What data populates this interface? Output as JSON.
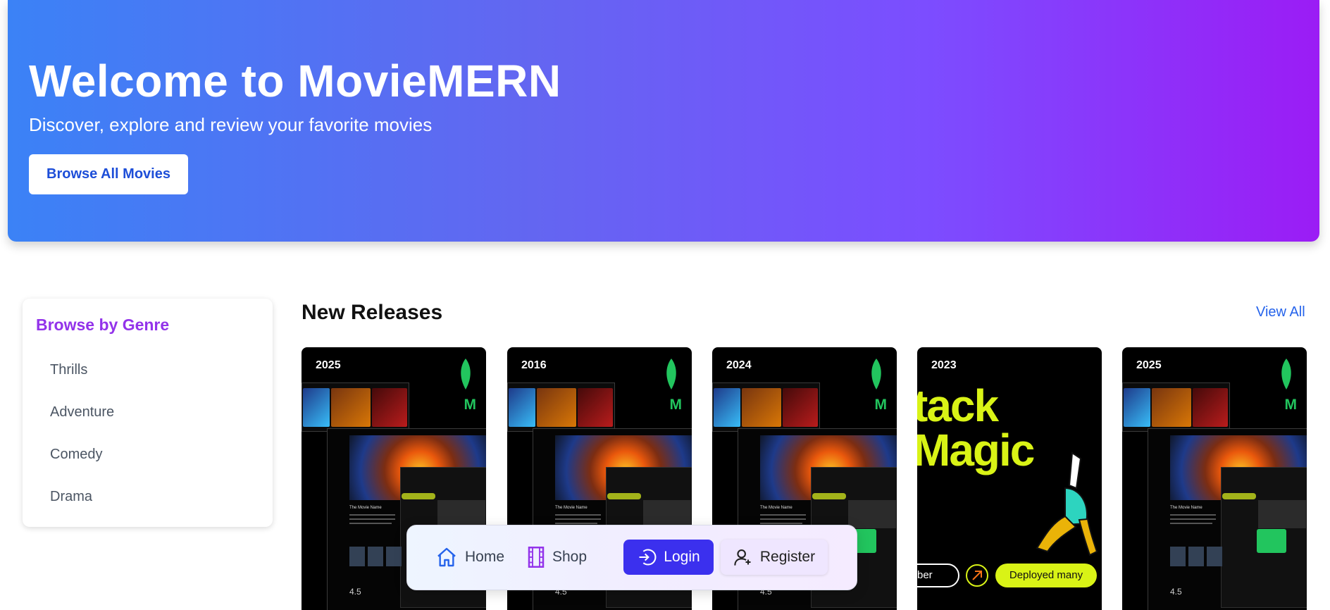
{
  "hero": {
    "title": "Welcome to MovieMERN",
    "subtitle": "Discover, explore and review your favorite movies",
    "button_label": "Browse All Movies"
  },
  "genres": {
    "title": "Browse by Genre",
    "items": [
      "Thrills",
      "Adventure",
      "Comedy",
      "Drama"
    ]
  },
  "releases": {
    "title": "New Releases",
    "view_all": "View All",
    "cards": [
      {
        "year": "2025",
        "image": "moviemern-app-screenshot",
        "mark": "M",
        "poster_title": "The Movie Name",
        "rating": "4.5"
      },
      {
        "year": "2016",
        "image": "moviemern-app-screenshot",
        "mark": "M",
        "poster_title": "The Movie Name",
        "rating": "4.5"
      },
      {
        "year": "2024",
        "image": "moviemern-app-screenshot",
        "mark": "M",
        "poster_title": "The Movie Name",
        "rating": "4.5"
      },
      {
        "year": "2023",
        "image": "stack-magic-poster",
        "headline": "tack\nMagic",
        "pill_outline": "ber",
        "pill_yellow": "Deployed many"
      },
      {
        "year": "2025",
        "image": "moviemern-app-screenshot",
        "mark": "M",
        "poster_title": "The Movie Name",
        "rating": "4.5"
      }
    ]
  },
  "dock": {
    "home": "Home",
    "shop": "Shop",
    "login": "Login",
    "register": "Register"
  },
  "colors": {
    "hero_gradient_start": "#3b82f6",
    "hero_gradient_end": "#9b1cf5",
    "genre_title": "#9333ea",
    "link": "#2563eb",
    "login_bg": "#3b30ee",
    "leaf_green": "#22c55e",
    "neon_yellow": "#d9f316"
  }
}
